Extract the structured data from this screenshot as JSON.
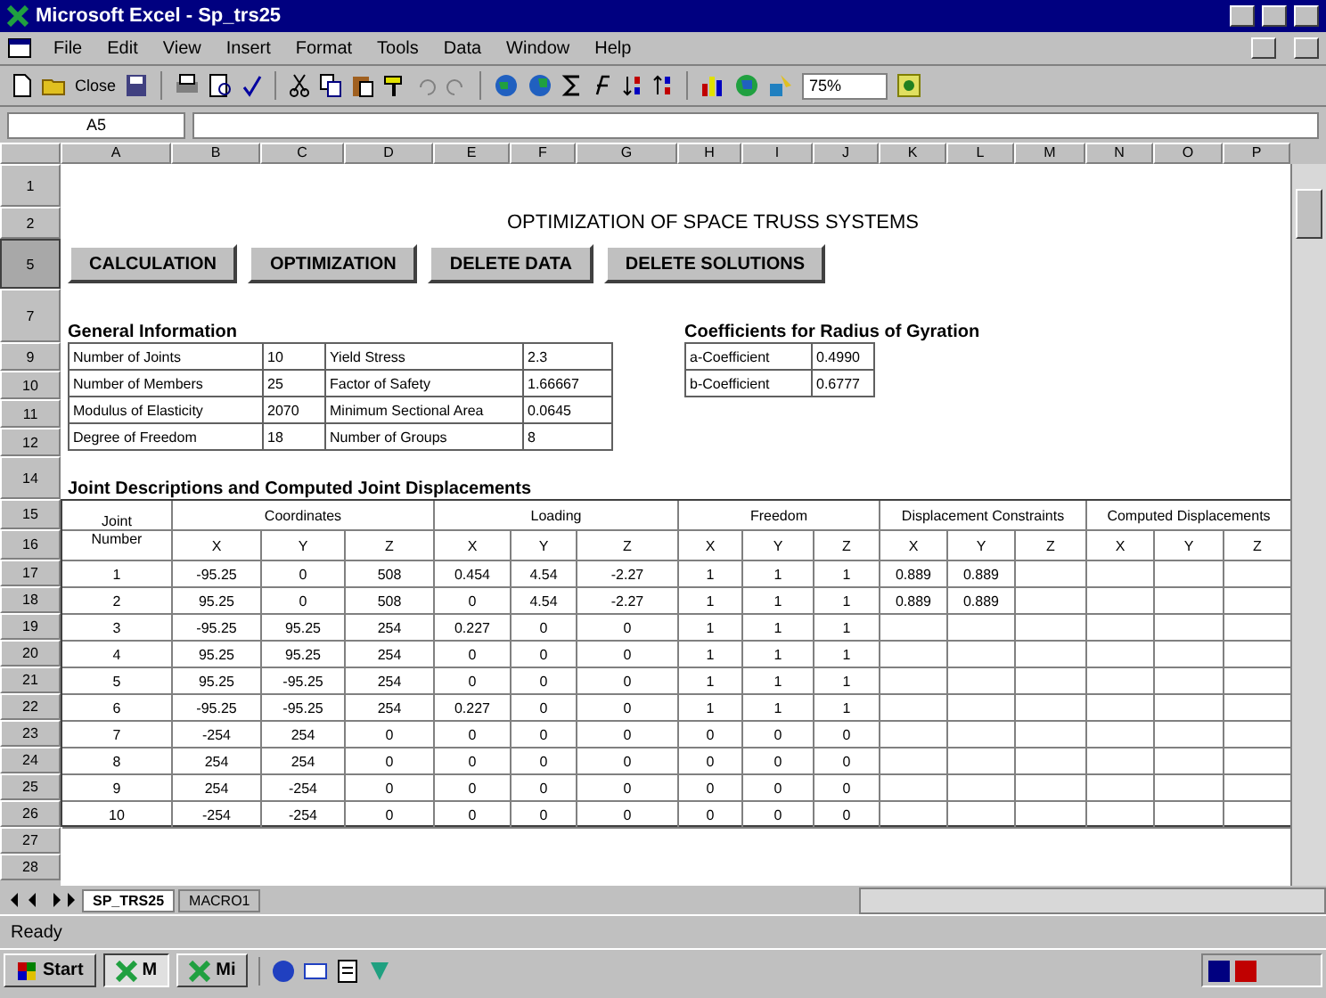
{
  "window": {
    "title": "Microsoft Excel - Sp_trs25"
  },
  "menu": [
    "File",
    "Edit",
    "View",
    "Insert",
    "Format",
    "Tools",
    "Data",
    "Window",
    "Help"
  ],
  "toolbar": {
    "close_label": "Close",
    "zoom": "75%"
  },
  "formula_bar": {
    "name_box": "A5"
  },
  "columns": [
    "A",
    "B",
    "C",
    "D",
    "E",
    "F",
    "G",
    "H",
    "I",
    "J",
    "K",
    "L",
    "M",
    "N",
    "O",
    "P"
  ],
  "rows": [
    {
      "label": "1",
      "selected": false
    },
    {
      "label": "2",
      "selected": false
    },
    {
      "label": "5",
      "selected": true
    },
    {
      "label": "7",
      "selected": false
    },
    {
      "label": "9",
      "selected": false
    },
    {
      "label": "10",
      "selected": false
    },
    {
      "label": "11",
      "selected": false
    },
    {
      "label": "12",
      "selected": false
    },
    {
      "label": "14",
      "selected": false
    },
    {
      "label": "15",
      "selected": false
    },
    {
      "label": "16",
      "selected": false
    },
    {
      "label": "17",
      "selected": false
    },
    {
      "label": "18",
      "selected": false
    },
    {
      "label": "19",
      "selected": false
    },
    {
      "label": "20",
      "selected": false
    },
    {
      "label": "21",
      "selected": false
    },
    {
      "label": "22",
      "selected": false
    },
    {
      "label": "23",
      "selected": false
    },
    {
      "label": "24",
      "selected": false
    },
    {
      "label": "25",
      "selected": false
    },
    {
      "label": "26",
      "selected": false
    },
    {
      "label": "27",
      "selected": false
    },
    {
      "label": "28",
      "selected": false
    }
  ],
  "sheet": {
    "title": "OPTIMIZATION OF SPACE TRUSS SYSTEMS",
    "buttons": [
      "CALCULATION",
      "OPTIMIZATION",
      "DELETE DATA",
      "DELETE SOLUTIONS"
    ],
    "general_information": {
      "heading": "General Information",
      "rows": [
        {
          "label": "Number of Joints",
          "value": "10",
          "label_2": "Yield Stress",
          "value_2": "2.3"
        },
        {
          "label": "Number of Members",
          "value": "25",
          "label_2": "Factor of Safety",
          "value_2": "1.66667"
        },
        {
          "label": "Modulus of Elasticity",
          "value": "2070",
          "label_2": "Minimum Sectional Area",
          "value_2": "0.0645"
        },
        {
          "label": "Degree of Freedom",
          "value": "18",
          "label_2": "Number of Groups",
          "value_2": "8"
        }
      ]
    },
    "coefficients": {
      "heading": "Coefficients for Radius of Gyration",
      "rows": [
        {
          "label": "a-Coefficient",
          "value": "0.4990"
        },
        {
          "label": "b-Coefficient",
          "value": "0.6777"
        }
      ]
    },
    "joints": {
      "heading": "Joint Descriptions and Computed Joint Displacements",
      "header": {
        "joint": "Joint",
        "number": "Number",
        "groups": [
          "Coordinates",
          "Loading",
          "Freedom",
          "Displacement Constraints",
          "Computed Displacements"
        ],
        "axes": [
          "X",
          "Y",
          "Z",
          "X",
          "Y",
          "Z",
          "X",
          "Y",
          "Z",
          "X",
          "Y",
          "Z",
          "X",
          "Y",
          "Z"
        ]
      },
      "rows": [
        [
          "1",
          "-95.25",
          "0",
          "508",
          "0.454",
          "4.54",
          "-2.27",
          "1",
          "1",
          "1",
          "0.889",
          "0.889"
        ],
        [
          "2",
          "95.25",
          "0",
          "508",
          "0",
          "4.54",
          "-2.27",
          "1",
          "1",
          "1",
          "0.889",
          "0.889"
        ],
        [
          "3",
          "-95.25",
          "95.25",
          "254",
          "0.227",
          "0",
          "0",
          "1",
          "1",
          "1"
        ],
        [
          "4",
          "95.25",
          "95.25",
          "254",
          "0",
          "0",
          "0",
          "1",
          "1",
          "1"
        ],
        [
          "5",
          "95.25",
          "-95.25",
          "254",
          "0",
          "0",
          "0",
          "1",
          "1",
          "1"
        ],
        [
          "6",
          "-95.25",
          "-95.25",
          "254",
          "0.227",
          "0",
          "0",
          "1",
          "1",
          "1"
        ],
        [
          "7",
          "-254",
          "254",
          "0",
          "0",
          "0",
          "0",
          "0",
          "0",
          "0"
        ],
        [
          "8",
          "254",
          "254",
          "0",
          "0",
          "0",
          "0",
          "0",
          "0",
          "0"
        ],
        [
          "9",
          "254",
          "-254",
          "0",
          "0",
          "0",
          "0",
          "0",
          "0",
          "0"
        ],
        [
          "10",
          "-254",
          "-254",
          "0",
          "0",
          "0",
          "0",
          "0",
          "0",
          "0"
        ]
      ]
    }
  },
  "sheet_tabs": [
    {
      "label": "SP_TRS25",
      "selected": true
    },
    {
      "label": "MACRO1",
      "selected": false
    }
  ],
  "status_bar": {
    "text": "Ready"
  },
  "taskbar": {
    "start": "Start",
    "tasks": [
      {
        "label": "M",
        "selected": true
      },
      {
        "label": "Mi",
        "selected": false
      }
    ]
  }
}
